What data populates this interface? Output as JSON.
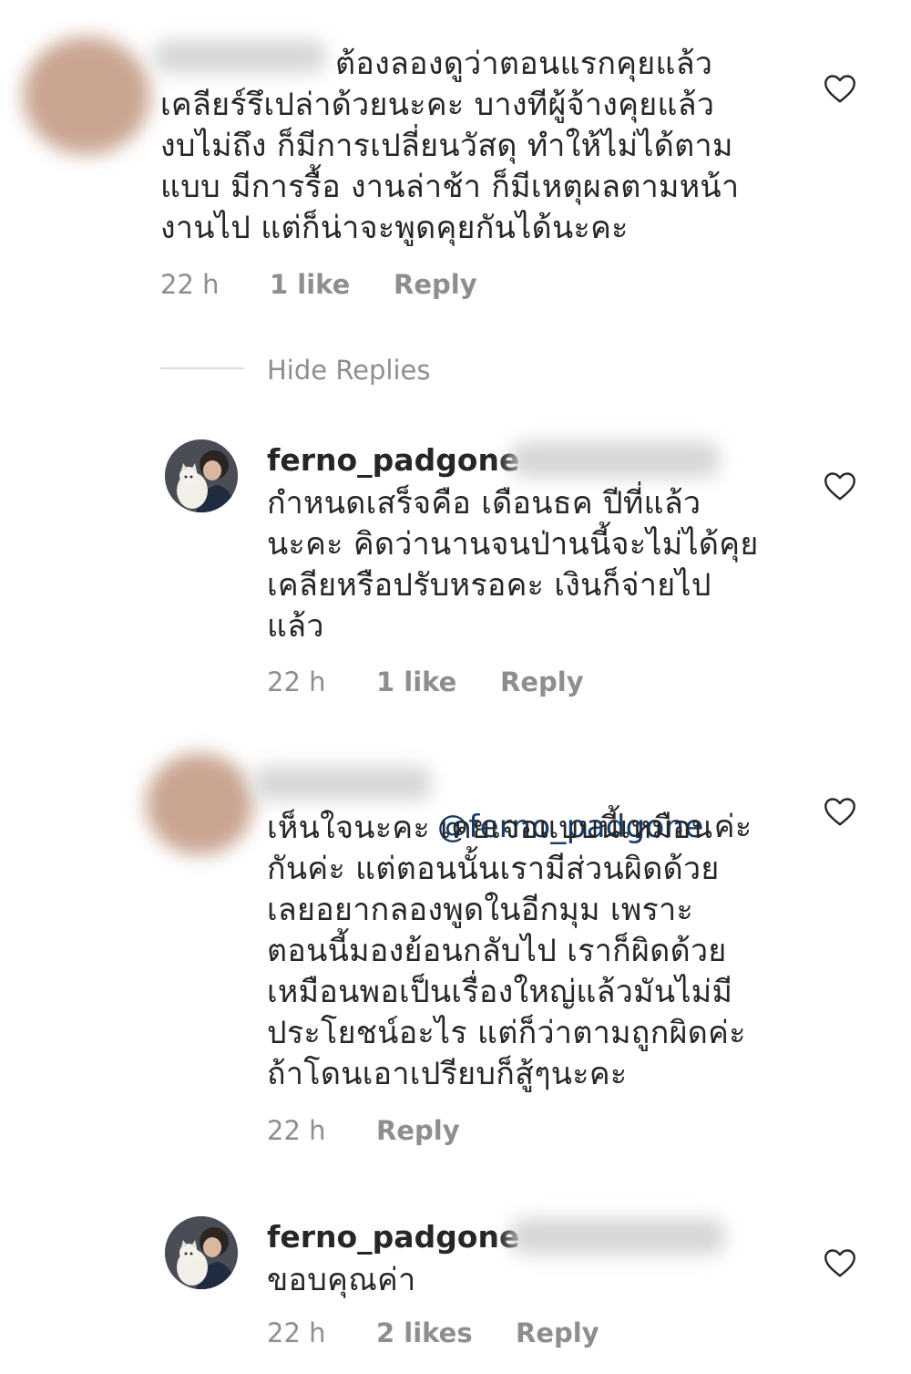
{
  "comments": [
    {
      "text": "ต้องลองดูว่าตอนแรกคุยแล้ว\nเคลียร์รึเปล่าด้วยนะคะ บางทีผู้จ้างคุยแล้ว\nงบไม่ถึง ก็มีการเปลี่ยนวัสดุ ทำให้ไม่ได้ตาม\nแบบ มีการรื้อ งานล่าช้า ก็มีเหตุผลตามหน้า\nงานไป แต่ก็น่าจะพูดคุยกันได้นะคะ",
      "time": "22 h",
      "likes": "1 like",
      "reply": "Reply"
    }
  ],
  "hide_replies": "Hide Replies",
  "replies": [
    {
      "username": "ferno_padgone",
      "text": "กำหนดเสร็จคือ เดือนธค ปีที่แล้ว\nนะคะ คิดว่านานจนป่านนี้จะไม่ได้คุย\nเคลียหรือปรับหรอคะ เงินก็จ่ายไป\nแล้ว",
      "time": "22 h",
      "likes": "1 like",
      "reply": "Reply"
    },
    {
      "mention": "@ferno_padgone",
      "text_first": " ค่ะ",
      "text": "เห็นใจนะคะ เคยเจอแบบนี้เหมือน\nกันค่ะ แต่ตอนนั้นเรามีส่วนผิดด้วย\nเลยอยากลองพูดในอีกมุม เพราะ\nตอนนี้มองย้อนกลับไป เราก็ผิดด้วย\nเหมือนพอเป็นเรื่องใหญ่แล้วมันไม่มี\nประโยชน์อะไร แต่ก็ว่าตามถูกผิดค่ะ\nถ้าโดนเอาเปรียบก็สู้ๆนะคะ",
      "time": "22 h",
      "reply": "Reply"
    },
    {
      "username": "ferno_padgone",
      "text": "ขอบคุณค่า",
      "time": "22 h",
      "likes": "2 likes",
      "reply": "Reply"
    }
  ],
  "icons": {
    "like": "heart-outline-icon"
  },
  "colors": {
    "meta": "#8e8e8e",
    "mention": "#173a66",
    "text": "#262626"
  }
}
